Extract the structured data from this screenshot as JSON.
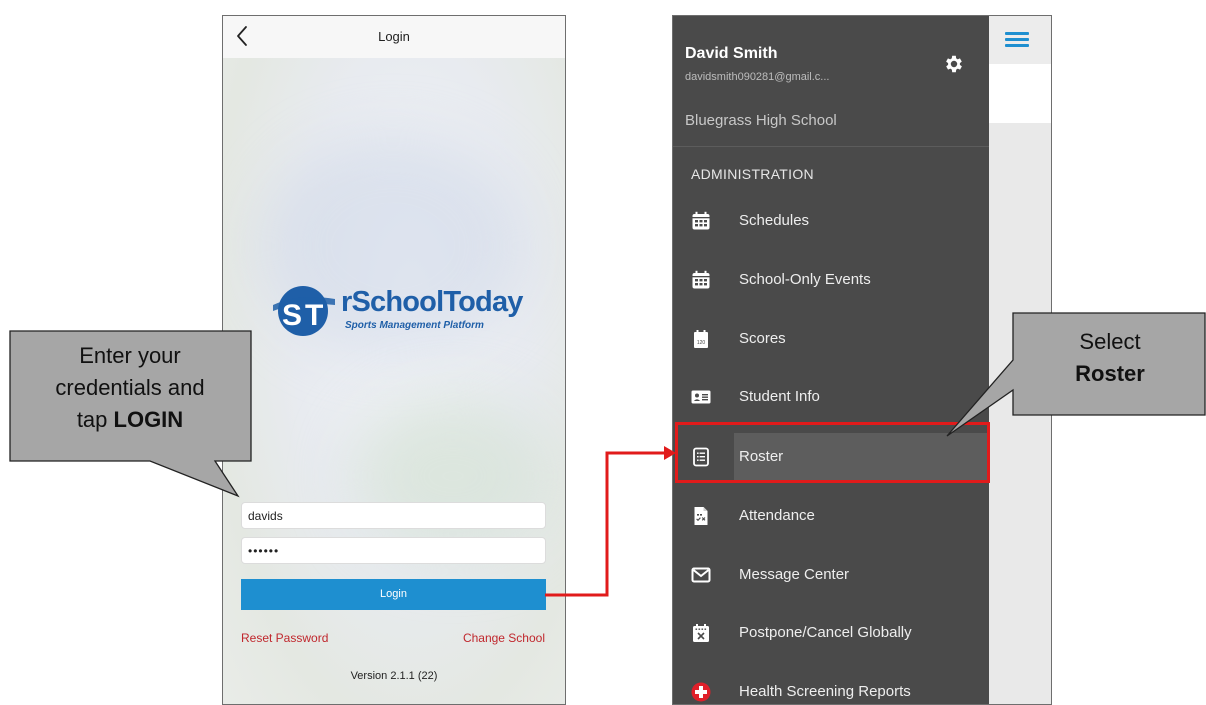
{
  "login_screen": {
    "title": "Login",
    "logo_text": "rSchoolToday",
    "logo_subtext": "Sports Management Platform",
    "username_value": "davids",
    "password_value": "••••••",
    "login_button_label": "Login",
    "reset_password_label": "Reset Password",
    "change_school_label": "Change School",
    "version": "Version 2.1.1 (22)"
  },
  "menu_screen": {
    "user_name": "David Smith",
    "user_email": "davidsmith090281@gmail.c...",
    "school": "Bluegrass High School",
    "section_title": "ADMINISTRATION",
    "items": [
      {
        "label": "Schedules",
        "icon": "calendar-icon"
      },
      {
        "label": "School-Only Events",
        "icon": "calendar-icon"
      },
      {
        "label": "Scores",
        "icon": "scoreboard-icon"
      },
      {
        "label": "Student Info",
        "icon": "id-card-icon"
      },
      {
        "label": "Roster",
        "icon": "roster-icon",
        "selected": true
      },
      {
        "label": "Attendance",
        "icon": "attendance-icon"
      },
      {
        "label": "Message Center",
        "icon": "envelope-icon"
      },
      {
        "label": "Postpone/Cancel Globally",
        "icon": "calendar-cancel-icon"
      },
      {
        "label": "Health Screening Reports",
        "icon": "health-cross-icon"
      }
    ]
  },
  "callouts": {
    "left": {
      "line1": "Enter your",
      "line2": "credentials and",
      "line3_prefix": "tap ",
      "line3_bold": "LOGIN"
    },
    "right": {
      "line1": "Select",
      "line2_bold": "Roster"
    }
  },
  "colors": {
    "accent_blue": "#1e8fd0",
    "brand_blue": "#1f5fa8",
    "link_red": "#c0272d",
    "menu_bg": "#4a4a4a",
    "highlight_red": "#e11b1b",
    "callout_fill": "#a6a6a6"
  }
}
